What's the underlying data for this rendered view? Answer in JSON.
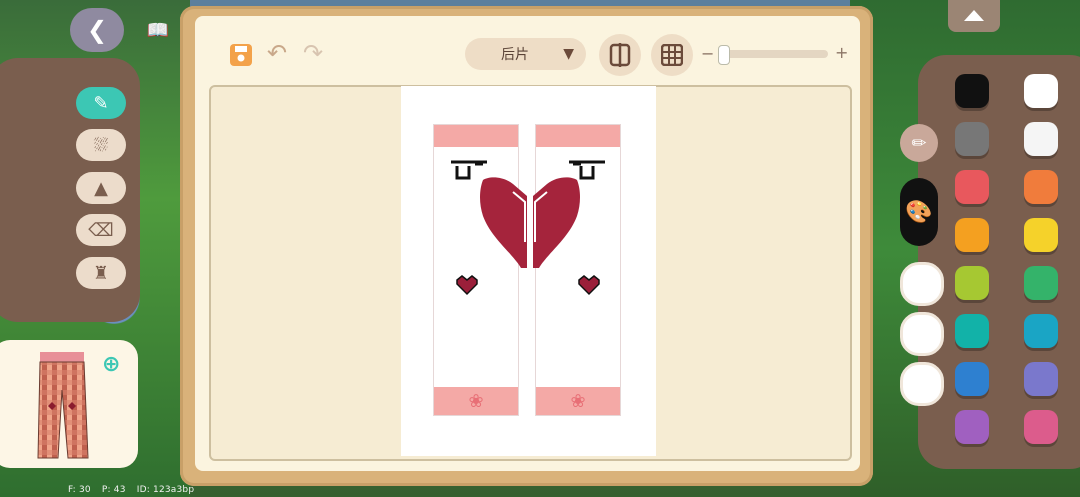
{
  "editor": {
    "part_selector": "后片",
    "undo_label": "undo",
    "redo_label": "redo"
  },
  "debug": {
    "fps": "F: 30",
    "ping": "P: 43",
    "id": "ID: 123a3bp"
  },
  "tools": [
    "pencil",
    "fill-bucket",
    "shapes",
    "eraser",
    "stamp"
  ],
  "palette": {
    "left_column": [
      "#111111",
      "#777777",
      "#e8585d",
      "#f4a020",
      "#a6c832",
      "#12b2a8",
      "#2e80d0",
      "#a060c0"
    ],
    "right_column": [
      "#ffffff",
      "#f5f5f5",
      "#f07c3c",
      "#f5d22a",
      "#34b36a",
      "#1aa5c5",
      "#7a78cc",
      "#dc5c8c"
    ],
    "custom_slots": [
      "#ffffff",
      "#ffffff",
      "#ffffff"
    ]
  }
}
